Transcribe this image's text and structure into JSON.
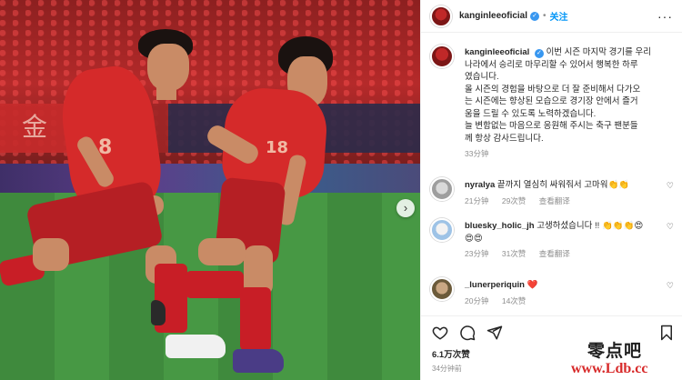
{
  "post": {
    "username": "kanginleeoficial",
    "follow_label": "关注",
    "more_label": "···",
    "caption_lines": [
      "이번 시즌 마지막 경기를 우리",
      "나라에서 승리로 마무리할 수 있어서 행복한 하루",
      "였습니다.",
      "올 시즌의 경험을 바탕으로 더 잘 준비해서 다가오",
      "는 시즌에는 향상된 모습으로 경기장 안에서 즐거",
      "움을 드릴 수 있도록 노력하겠습니다.",
      "늘 변함없는 마음으로 응원해 주시는 축구 팬분들",
      "께 항상 감사드립니다."
    ],
    "caption_time": "33分钟",
    "likes": "6.1万次赞",
    "date": "34分钟前"
  },
  "comments": [
    {
      "username": "nyralya",
      "text": "끝까지 열심히 싸워줘서 고마워👏👏",
      "time": "21分钟",
      "likes": "29次赞",
      "translate": "查看翻译"
    },
    {
      "username": "bluesky_holic_jh",
      "text": "고생하셨습니다 !! 👏👏👏😍",
      "text2": "😍😍",
      "time": "23分钟",
      "likes": "31次赞",
      "translate": "查看翻译"
    },
    {
      "username": "_lunerperiquin",
      "text": "❤️",
      "time": "20分钟",
      "likes": "14次赞",
      "translate": ""
    }
  ],
  "icons": {
    "verified": "verified-badge-icon",
    "heart": "heart-icon",
    "comment": "comment-icon",
    "share": "share-icon",
    "save": "bookmark-icon",
    "next": "chevron-right-icon",
    "more": "more-options-icon"
  },
  "photo": {
    "banner_text": "金",
    "jersey_numbers": [
      "8",
      "18"
    ]
  },
  "watermark": {
    "line1": "零点吧",
    "line2": "www.Ldb.cc"
  },
  "colors": {
    "accent": "#0095f6",
    "verified": "#3897f0",
    "jersey": "#d52a2a",
    "watermark_red": "#d72a2a"
  }
}
